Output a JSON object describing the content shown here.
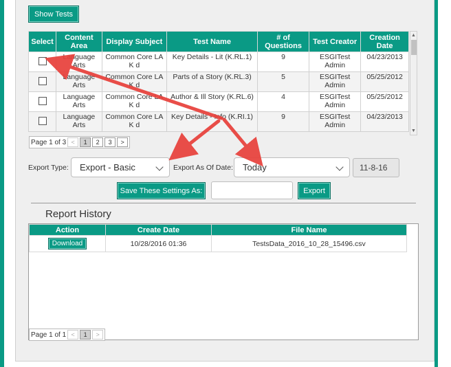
{
  "show_tests_label": "Show Tests",
  "tests_table": {
    "columns": [
      "Select",
      "Content Area",
      "Display Subject",
      "Test Name",
      "# of Questions",
      "Test Creator",
      "Creation Date"
    ],
    "rows": [
      {
        "content_area": "Language Arts",
        "display_subject": "Common Core LA K d",
        "test_name": "Key Details - Lit (K.RL.1)",
        "questions": "9",
        "creator": "ESGITest Admin",
        "date": "04/23/2013"
      },
      {
        "content_area": "Language Arts",
        "display_subject": "Common Core LA K d",
        "test_name": "Parts of a Story (K.RL.3)",
        "questions": "5",
        "creator": "ESGITest Admin",
        "date": "05/25/2012"
      },
      {
        "content_area": "Language Arts",
        "display_subject": "Common Core LA K d",
        "test_name": "Author & Ill Story (K.RL.6)",
        "questions": "4",
        "creator": "ESGITest Admin",
        "date": "05/25/2012"
      },
      {
        "content_area": "Language Arts",
        "display_subject": "Common Core LA K d",
        "test_name": "Key Details - Info (K.RI.1)",
        "questions": "9",
        "creator": "ESGITest Admin",
        "date": "04/23/2013"
      }
    ]
  },
  "tests_pager": {
    "text": "Page 1 of 3",
    "prev": "<",
    "pages": [
      "1",
      "2",
      "3"
    ],
    "next": ">"
  },
  "export_type_label": "Export Type:",
  "export_type_value": "Export - Basic",
  "export_as_of_label": "Export As Of Date:",
  "export_as_of_value": "Today",
  "date_value": "11-8-16",
  "save_settings_label": "Save These Settings As:",
  "save_settings_input": "",
  "export_button_label": "Export",
  "report_history_title": "Report History",
  "history_table": {
    "columns": [
      "Action",
      "Create Date",
      "File Name"
    ],
    "rows": [
      {
        "action": "Download",
        "date": "10/28/2016 01:36",
        "file": "TestsData_2016_10_28_15496.csv"
      }
    ]
  },
  "history_pager": {
    "text": "Page 1 of 1",
    "prev": "<",
    "pages": [
      "1"
    ],
    "next": ">"
  },
  "colors": {
    "accent": "#0a9a85",
    "arrow": "#e8403a"
  }
}
